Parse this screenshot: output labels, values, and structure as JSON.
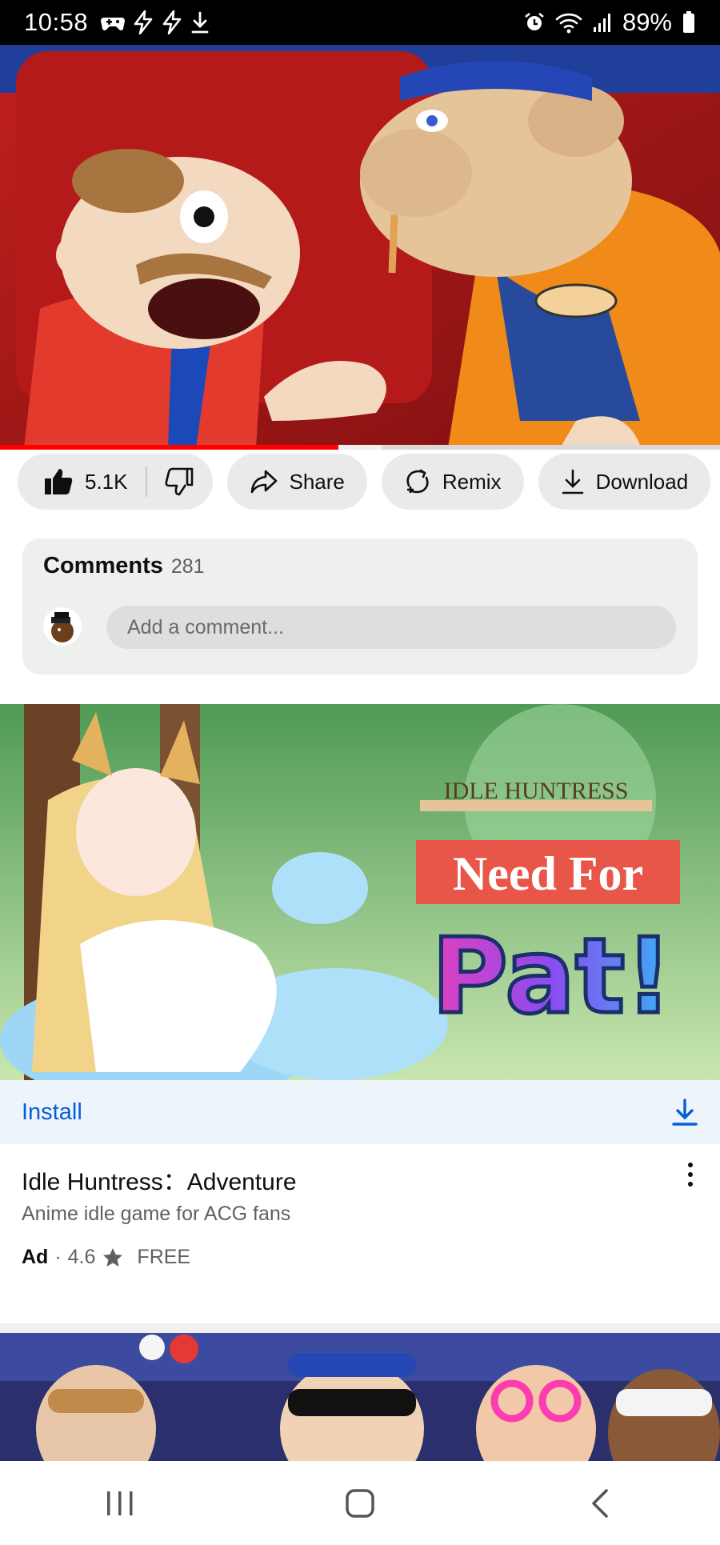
{
  "status_bar": {
    "time": "10:58",
    "battery": "89%",
    "left_icons": [
      "gamepad-icon",
      "bolt-icon",
      "bolt-icon",
      "download-icon"
    ],
    "right_icons": [
      "alarm-icon",
      "wifi-icon",
      "signal-icon",
      "battery-icon"
    ]
  },
  "video": {
    "progress_fraction": 0.47
  },
  "actions": {
    "like_count": "5.1K",
    "share": "Share",
    "remix": "Remix",
    "download": "Download"
  },
  "comments": {
    "title": "Comments",
    "count": "281",
    "placeholder": "Add a comment..."
  },
  "ad": {
    "image_texts": {
      "logo": "IDLE HUNTRESS",
      "banner": "Need For",
      "headline": "Pat!"
    },
    "install_label": "Install",
    "title": "Idle Huntress：Adventure",
    "description": "Anime idle game for ACG fans",
    "badge": "Ad",
    "separator": "·",
    "rating": "4.6",
    "price": "FREE"
  },
  "nav": {
    "buttons": [
      "recents-icon",
      "home-icon",
      "back-icon"
    ]
  },
  "colors": {
    "accent_blue": "#065fd4",
    "progress_red": "#ff0000",
    "pill_bg": "#eaeaea"
  }
}
